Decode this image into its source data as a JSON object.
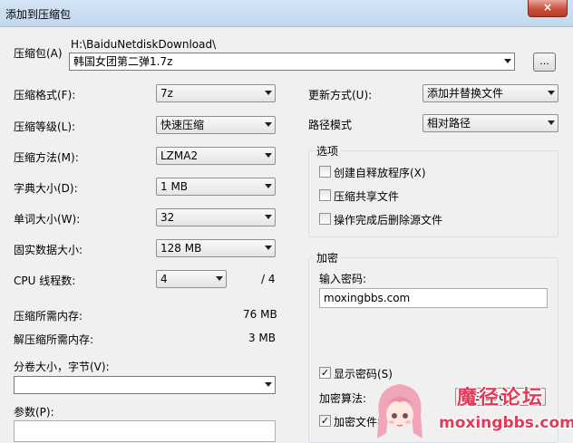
{
  "window": {
    "title": "添加到压缩包",
    "close_glyph": "×"
  },
  "archive": {
    "label": "压缩包(A)",
    "path": "H:\\BaiduNetdiskDownload\\",
    "filename": "韩国女团第二弹1.7z",
    "browse_label": "..."
  },
  "left": {
    "format": {
      "label": "压缩格式(F):",
      "value": "7z"
    },
    "level": {
      "label": "压缩等级(L):",
      "value": "快速压缩"
    },
    "method": {
      "label": "压缩方法(M):",
      "value": "LZMA2"
    },
    "dict": {
      "label": "字典大小(D):",
      "value": "1 MB"
    },
    "word": {
      "label": "单词大小(W):",
      "value": "32"
    },
    "solid": {
      "label": "固实数据大小:",
      "value": "128 MB"
    },
    "threads": {
      "label": "CPU 线程数:",
      "value": "4",
      "total": "/ 4"
    },
    "mem_compress": {
      "label": "压缩所需内存:",
      "value": "76 MB"
    },
    "mem_decompress": {
      "label": "解压缩所需内存:",
      "value": "3 MB"
    },
    "volume": {
      "label": "分卷大小，字节(V):",
      "value": ""
    },
    "params": {
      "label": "参数(P):",
      "value": ""
    }
  },
  "right": {
    "update": {
      "label": "更新方式(U):",
      "value": "添加并替换文件"
    },
    "pathmode": {
      "label": "路径模式",
      "value": "相对路径"
    },
    "options": {
      "title": "选项",
      "items": [
        {
          "label": "创建自释放程序(X)",
          "checked": false,
          "mark": ""
        },
        {
          "label": "压缩共享文件",
          "checked": false,
          "mark": ""
        },
        {
          "label": "操作完成后删除源文件",
          "checked": false,
          "mark": ""
        }
      ]
    },
    "encryption": {
      "title": "加密",
      "password_label": "输入密码:",
      "password_value": "moxingbbs.com",
      "show_password": {
        "label": "显示密码(S)",
        "checked": true,
        "mark": "✓"
      },
      "algo_label": "加密算法:",
      "algo_value": "AES-256",
      "encrypt_names": {
        "label": "加密文件名",
        "checked": true,
        "mark": "✓"
      }
    }
  },
  "watermark": {
    "site_name": "魔径论坛",
    "url": "moxingbbs.com"
  }
}
